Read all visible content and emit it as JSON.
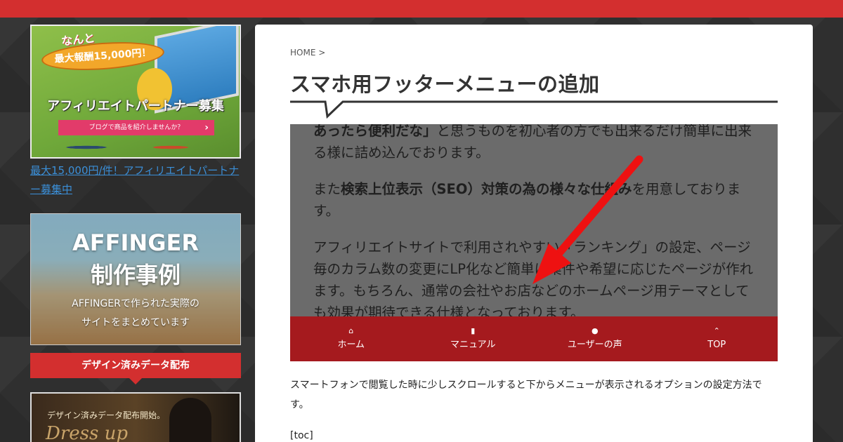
{
  "sidebar": {
    "banner1": {
      "badge": "なんと",
      "reward": "最大報酬15,000円！",
      "title": "アフィリエイトパートナー募集",
      "cta": "ブログで商品を紹介しませんか？"
    },
    "link_text": "最大15,000円/件！アフィリエイトパートナー募集中",
    "banner2": {
      "line1": "AFFINGER",
      "line2": "制作事例",
      "sub1": "AFFINGERで作られた実際の",
      "sub2": "サイトをまとめています"
    },
    "section_heading": "デザイン済みデータ配布",
    "banner3": {
      "text": "デザイン済みデータ配布開始。",
      "script": "Dress up"
    }
  },
  "article": {
    "breadcrumb": "HOME >",
    "title": "スマホ用フッターメニューの追加",
    "figure": {
      "para1_bold": "あったら便利だな」",
      "para1_rest": "と思うものを初心者の方でも出来るだけ簡単に出来る様に詰め込んでおります。",
      "para2_a": "また",
      "para2_bold": "検索上位表示（SEO）対策の為の様々な仕組み",
      "para2_b": "を用意しております。",
      "para3": "アフィリエイトサイトで利用されやすい「ランキング」の設定、ページ毎のカラム数の変更にLP化など簡単に案件や希望に応じたページが作れます。もちろん、通常の会社やお店などのホームページ用テーマとしても効果が期待できる仕様となっております。",
      "footer_menu": [
        {
          "icon": "home-icon",
          "glyph": "⌂",
          "label": "ホーム"
        },
        {
          "icon": "book-icon",
          "glyph": "▮",
          "label": "マニュアル"
        },
        {
          "icon": "comments-icon",
          "glyph": "●",
          "label": "ユーザーの声"
        },
        {
          "icon": "double-chevron-up-icon",
          "glyph": "⌃",
          "label": "TOP"
        }
      ],
      "arrow_color": "#ee1111",
      "footer_color": "#a51a1e"
    },
    "lead": "スマートフォンで閲覧した時に少しスクロールすると下からメニューが表示されるオプションの設定方法です。",
    "toc": "[toc]"
  },
  "colors": {
    "accent": "#d32f2f",
    "background": "#2f2f2f",
    "link": "#3b8fd8"
  }
}
